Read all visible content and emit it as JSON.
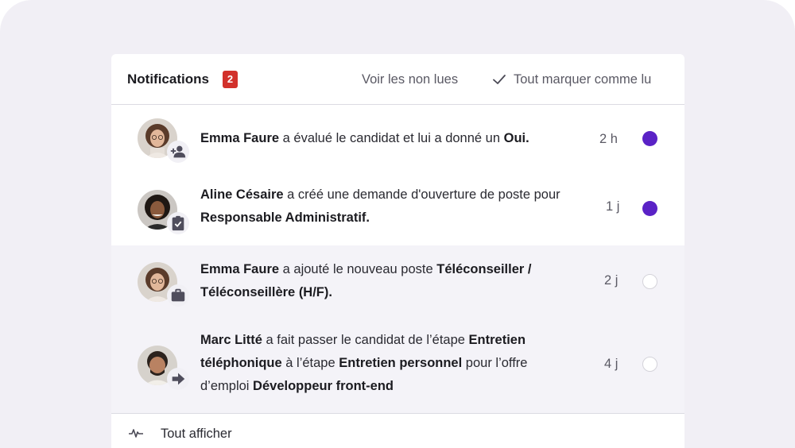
{
  "header": {
    "title": "Notifications",
    "count": "2",
    "unread_label": "Voir les non lues",
    "mark_all_label": "Tout marquer comme lu"
  },
  "notifications": [
    {
      "actor": "Emma Faure",
      "parts": [
        "a évalué le candidat et lui a donné un",
        "Oui."
      ],
      "time": "2 h",
      "unread": true,
      "badge_icon": "person-add-icon"
    },
    {
      "actor": "Aline Césaire",
      "parts": [
        "a créé une demande d'ouverture de poste pour",
        "Responsable Administratif."
      ],
      "time": "1 j",
      "unread": true,
      "badge_icon": "clipboard-check-icon"
    },
    {
      "actor": "Emma Faure",
      "parts": [
        "a ajouté le nouveau poste",
        "Téléconseiller / Téléconseillère (H/F)."
      ],
      "time": "2 j",
      "unread": false,
      "badge_icon": "briefcase-icon"
    },
    {
      "actor": "Marc Litté",
      "parts": [
        "a fait passer le candidat de l’étape",
        "Entretien téléphonique",
        "à l’étape",
        "Entretien personnel",
        "pour l’offre d’emploi",
        "Développeur front-end"
      ],
      "time": "4 j",
      "unread": false,
      "badge_icon": "arrow-right-icon"
    }
  ],
  "footer": {
    "show_all_label": "Tout afficher",
    "icon": "activity-icon"
  },
  "colors": {
    "accent": "#5a22c6",
    "badge_red": "#d2312b",
    "read_row_bg": "#f4f3f8",
    "frame_bg": "#f1eff5"
  }
}
